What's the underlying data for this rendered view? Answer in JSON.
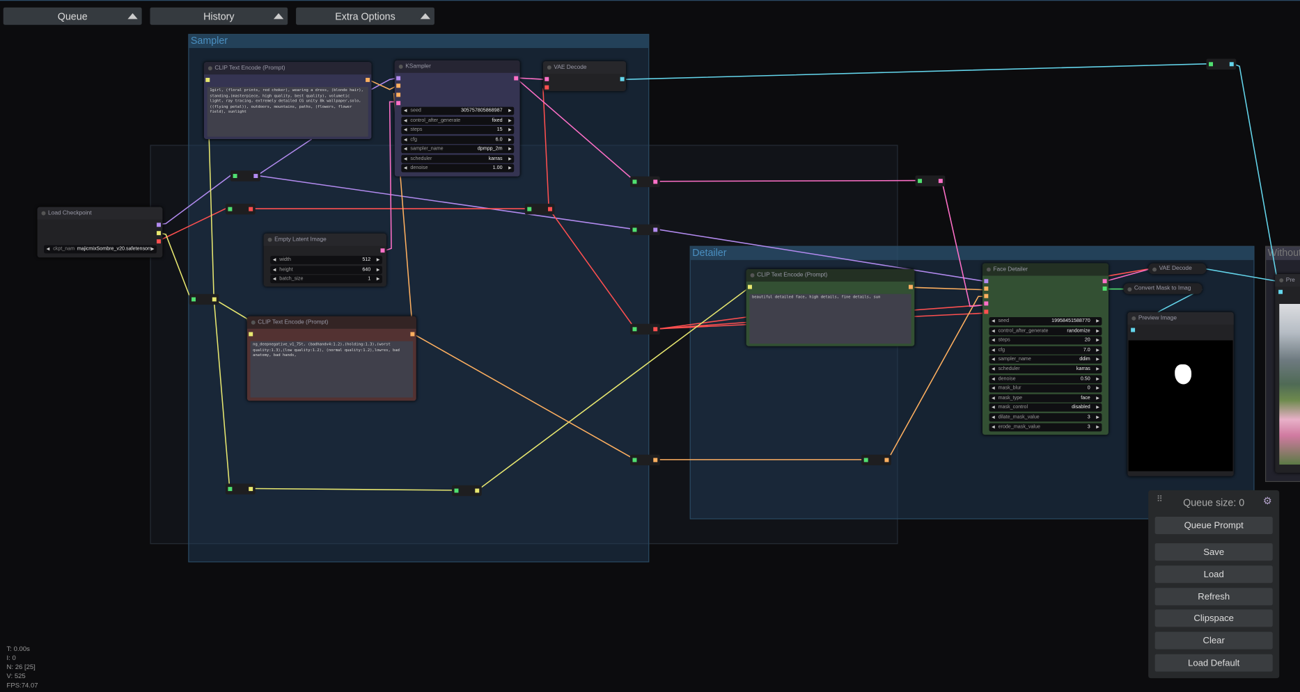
{
  "menu": {
    "queue": "Queue",
    "history": "History",
    "extra": "Extra Options"
  },
  "groups": {
    "sampler": "Sampler",
    "detailer": "Detailer",
    "without": "Without"
  },
  "nodes": {
    "clip_pos": {
      "title": "CLIP Text Encode (Prompt)",
      "text": "1girl, (floral prints, red choker), wearing a dress, (blonde hair), standing,(masterpiece, high quality, best quality), volumetic light, ray tracing, extremely detailed CG unity 8k wallpaper,solo, ((flying petal)), outdoors, mountains, paths, (flowers, flower field), sunlight"
    },
    "ksampler": {
      "title": "KSampler",
      "widgets": [
        [
          "seed",
          "305757805868987"
        ],
        [
          "control_after_generate",
          "fixed"
        ],
        [
          "steps",
          "15"
        ],
        [
          "cfg",
          "6.0"
        ],
        [
          "sampler_name",
          "dpmpp_2m"
        ],
        [
          "scheduler",
          "karras"
        ],
        [
          "denoise",
          "1.00"
        ]
      ]
    },
    "vae": {
      "title": "VAE Decode"
    },
    "ckpt": {
      "title": "Load Checkpoint",
      "label": "ckpt_nam",
      "value": "majicmixSombre_v20.safetensors"
    },
    "latent": {
      "title": "Empty Latent Image",
      "widgets": [
        [
          "width",
          "512"
        ],
        [
          "height",
          "640"
        ],
        [
          "batch_size",
          "1"
        ]
      ]
    },
    "clip_neg": {
      "title": "CLIP Text Encode (Prompt)",
      "text": "ng_deepnegative_v1_75t, (badhandv4:1.2),(holding:1.3),(worst quality:1.3),(low quality:1.2), (normal quality:1.2),lowres, bad anatomy, bad hands,"
    },
    "clip_det": {
      "title": "CLIP Text Encode (Prompt)",
      "text": "beautiful detailed face, high details, fine details, sun"
    },
    "face": {
      "title": "Face Detailer",
      "widgets": [
        [
          "seed",
          "19958451588770"
        ],
        [
          "control_after_generate",
          "randomize"
        ],
        [
          "steps",
          "20"
        ],
        [
          "cfg",
          "7.0"
        ],
        [
          "sampler_name",
          "ddim"
        ],
        [
          "scheduler",
          "karras"
        ],
        [
          "denoise",
          "0.50"
        ],
        [
          "mask_blur",
          "0"
        ],
        [
          "mask_type",
          "face"
        ],
        [
          "mask_control",
          "disabled"
        ],
        [
          "dilate_mask_value",
          "3"
        ],
        [
          "erode_mask_value",
          "3"
        ]
      ]
    },
    "vae2": {
      "title": "VAE Decode"
    },
    "convert": {
      "title": "Convert Mask to Imag"
    },
    "preview": {
      "title": "Preview Image"
    },
    "preview2": {
      "title": "Pre"
    }
  },
  "panel": {
    "queue_size": "Queue size: 0",
    "buttons": [
      "Queue Prompt",
      "Save",
      "Load",
      "Refresh",
      "Clipspace",
      "Clear",
      "Load Default"
    ]
  },
  "stats": {
    "t": "T: 0.00s",
    "i": "I: 0",
    "n": "N: 26 [25]",
    "v": "V: 525",
    "fps": "FPS:74.07"
  },
  "colors": {
    "clip": "#e8e870",
    "model": "#b38bf0",
    "vae": "#ff5050",
    "latent": "#ff70c8",
    "cond": "#ffb060",
    "image": "#64d6ec",
    "mask": "#50e070"
  }
}
